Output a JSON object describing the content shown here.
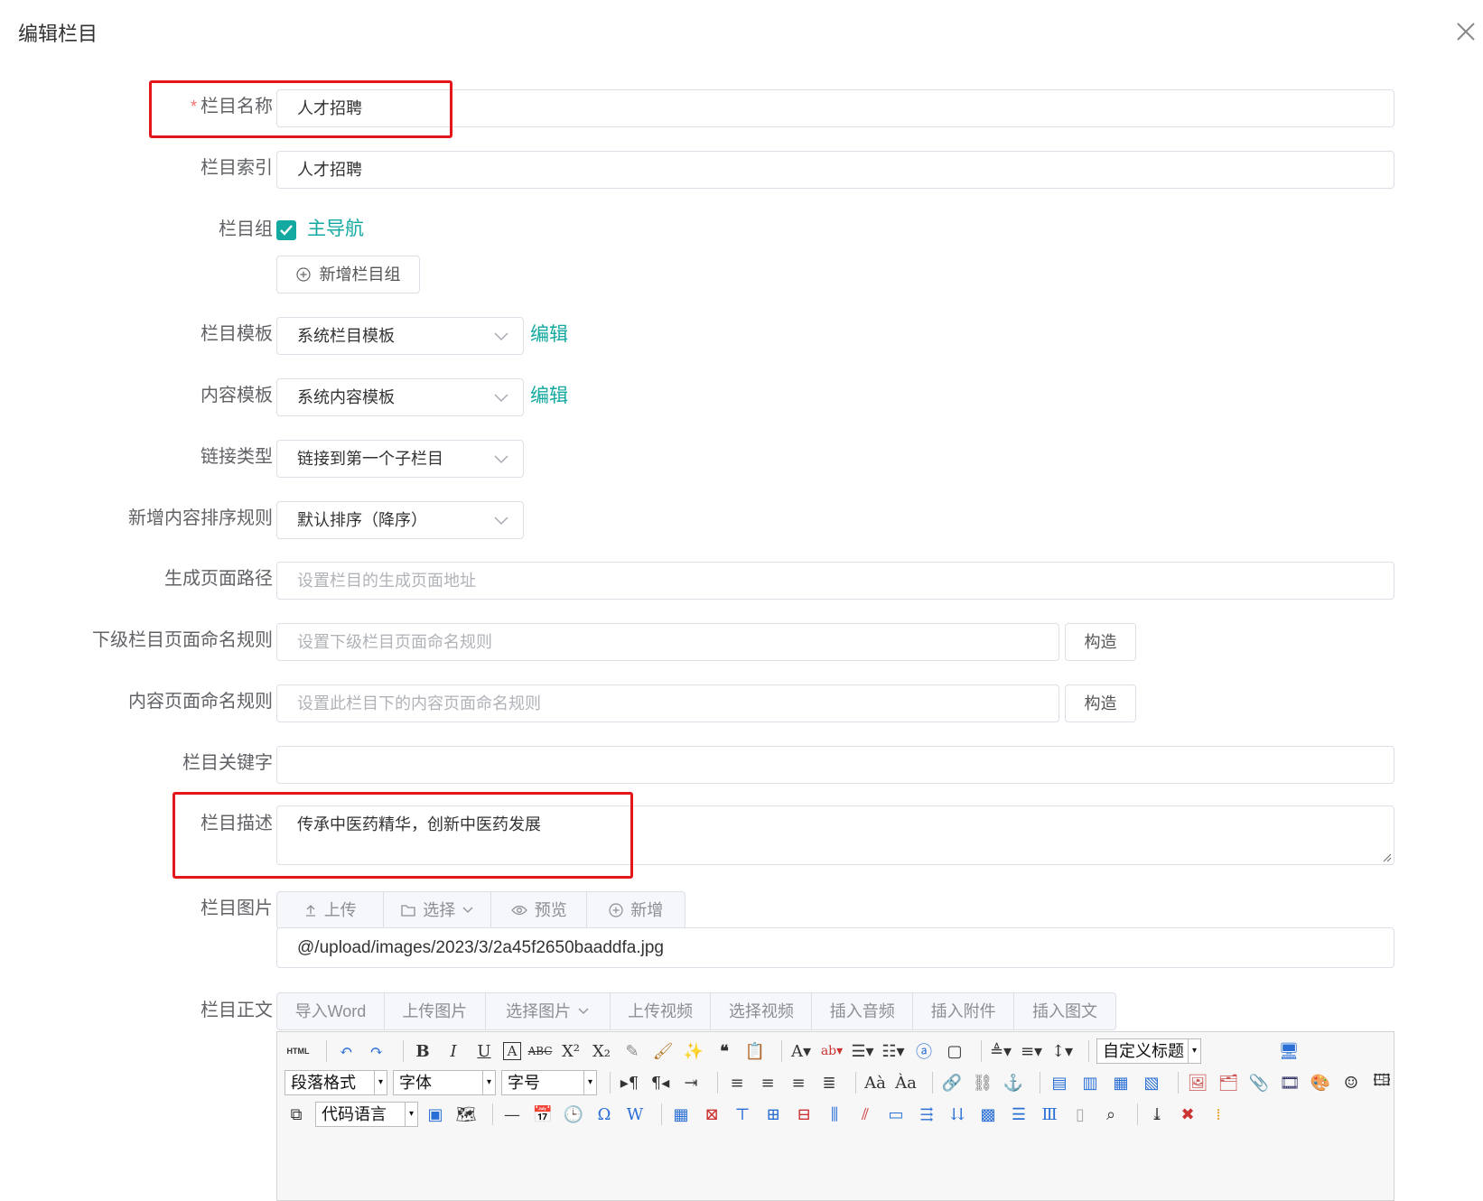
{
  "dialog": {
    "title": "编辑栏目",
    "close_icon": "close-icon"
  },
  "form": {
    "column_name": {
      "label": "栏目名称",
      "required_mark": "*",
      "value": "人才招聘"
    },
    "column_index": {
      "label": "栏目索引",
      "value": "人才招聘"
    },
    "column_group": {
      "label": "栏目组",
      "checkbox_label": "主导航",
      "checked": true,
      "add_button": "新增栏目组"
    },
    "column_template": {
      "label": "栏目模板",
      "value": "系统栏目模板",
      "edit_link": "编辑"
    },
    "content_template": {
      "label": "内容模板",
      "value": "系统内容模板",
      "edit_link": "编辑"
    },
    "link_type": {
      "label": "链接类型",
      "value": "链接到第一个子栏目"
    },
    "sort_rule": {
      "label": "新增内容排序规则",
      "value": "默认排序（降序）"
    },
    "page_path": {
      "label": "生成页面路径",
      "placeholder": "设置栏目的生成页面地址"
    },
    "child_naming": {
      "label": "下级栏目页面命名规则",
      "placeholder": "设置下级栏目页面命名规则",
      "button": "构造"
    },
    "content_naming": {
      "label": "内容页面命名规则",
      "placeholder": "设置此栏目下的内容页面命名规则",
      "button": "构造"
    },
    "keywords": {
      "label": "栏目关键字",
      "value": ""
    },
    "description": {
      "label": "栏目描述",
      "value": "传承中医药精华，创新中医药发展"
    },
    "image": {
      "label": "栏目图片",
      "buttons": [
        "上传",
        "选择",
        "预览",
        "新增"
      ],
      "value": "@/upload/images/2023/3/2a45f2650baaddfa.jpg"
    },
    "body": {
      "label": "栏目正文",
      "buttons": [
        "导入Word",
        "上传图片",
        "选择图片",
        "上传视频",
        "选择视频",
        "插入音频",
        "插入附件",
        "插入图文"
      ]
    }
  },
  "editor": {
    "custom_heading": "自定义标题",
    "paragraph_format": "段落格式",
    "font_family": "字体",
    "font_size": "字号",
    "code_language": "代码语言",
    "html_label": "HTML"
  },
  "colors": {
    "accent": "#13a8a0",
    "highlight": "#e3161c",
    "required": "#f56c6c"
  }
}
